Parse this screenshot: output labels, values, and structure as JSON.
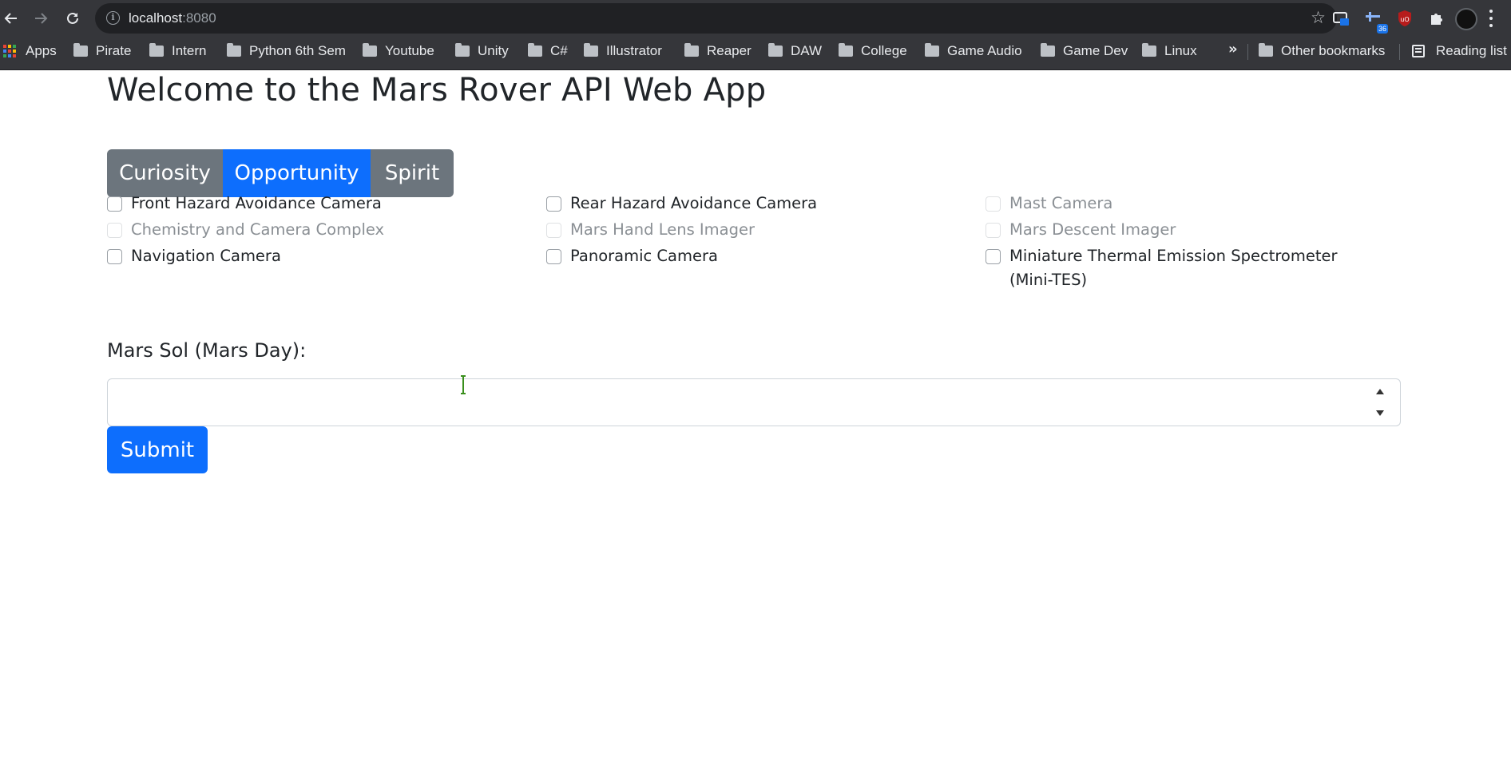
{
  "browser": {
    "url_host": "localhost",
    "url_port": ":8080",
    "extension_badge": "36",
    "bookmarks": [
      {
        "label": "Apps",
        "type": "apps"
      },
      {
        "label": "Pirate",
        "type": "folder"
      },
      {
        "label": "Intern",
        "type": "folder"
      },
      {
        "label": "Python 6th Sem",
        "type": "folder"
      },
      {
        "label": "Youtube",
        "type": "folder"
      },
      {
        "label": "Unity",
        "type": "folder"
      },
      {
        "label": "C#",
        "type": "folder"
      },
      {
        "label": "Illustrator",
        "type": "folder"
      },
      {
        "label": "Reaper",
        "type": "folder"
      },
      {
        "label": "DAW",
        "type": "folder"
      },
      {
        "label": "College",
        "type": "folder"
      },
      {
        "label": "Game Audio",
        "type": "folder"
      },
      {
        "label": "Game Dev",
        "type": "folder"
      },
      {
        "label": "Linux",
        "type": "folder"
      }
    ],
    "overflow_chevron": "»",
    "other_bookmarks": "Other bookmarks",
    "reading_list": "Reading list"
  },
  "page": {
    "title": "Welcome to the Mars Rover API Web App",
    "rovers": [
      {
        "label": "Curiosity",
        "active": false
      },
      {
        "label": "Opportunity",
        "active": true
      },
      {
        "label": "Spirit",
        "active": false
      }
    ],
    "cameras": {
      "col1": [
        {
          "label": "Front Hazard Avoidance Camera",
          "enabled": true,
          "checked": false
        },
        {
          "label": "Chemistry and Camera Complex",
          "enabled": false,
          "checked": false
        },
        {
          "label": "Navigation Camera",
          "enabled": true,
          "checked": false
        }
      ],
      "col2": [
        {
          "label": "Rear Hazard Avoidance Camera",
          "enabled": true,
          "checked": false
        },
        {
          "label": "Mars Hand Lens Imager",
          "enabled": false,
          "checked": false
        },
        {
          "label": "Panoramic Camera",
          "enabled": true,
          "checked": false
        }
      ],
      "col3": [
        {
          "label": "Mast Camera",
          "enabled": false,
          "checked": false
        },
        {
          "label": "Mars Descent Imager",
          "enabled": false,
          "checked": false
        },
        {
          "label": "Miniature Thermal Emission Spectrometer (Mini-TES)",
          "enabled": true,
          "checked": false
        }
      ]
    },
    "sol_label": "Mars Sol (Mars Day):",
    "sol_value": "",
    "submit_label": "Submit"
  },
  "colors": {
    "primary": "#0d6efd",
    "secondary": "#6c757d",
    "chrome": "#35363a",
    "omnibox": "#202124"
  }
}
